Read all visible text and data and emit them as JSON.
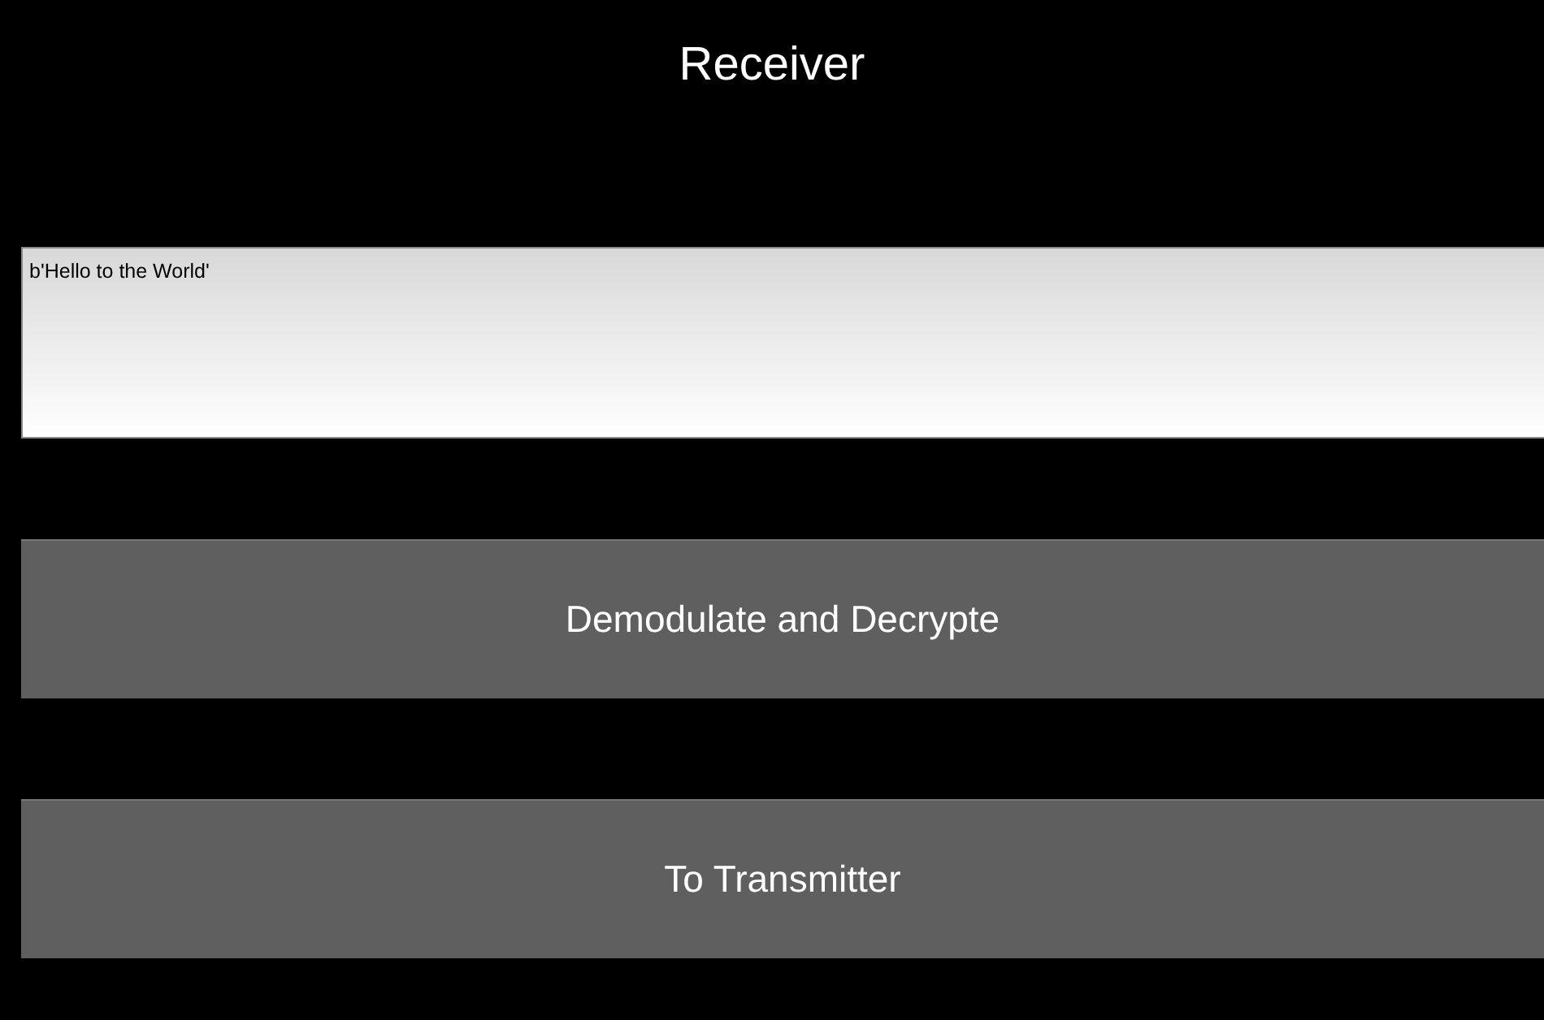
{
  "title": "Receiver",
  "output": {
    "value": "b'Hello to the World'"
  },
  "buttons": [
    {
      "label": "Demodulate and Decrypte"
    },
    {
      "label": "To Transmitter"
    }
  ]
}
